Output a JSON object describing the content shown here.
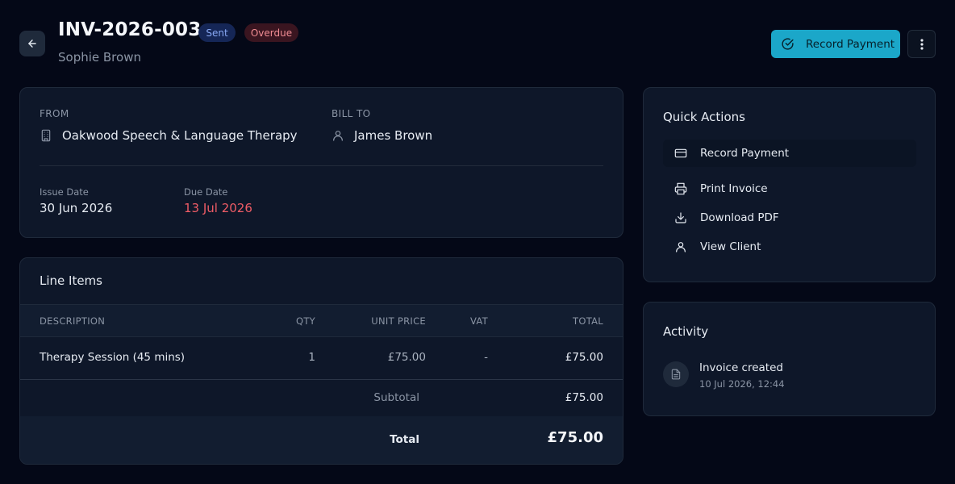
{
  "header": {
    "invoice_number": "INV-2026-003",
    "client_name": "Sophie Brown",
    "badges": {
      "sent": "Sent",
      "overdue": "Overdue"
    },
    "record_payment_label": "Record Payment"
  },
  "details": {
    "from_label": "FROM",
    "from_name": "Oakwood Speech & Language Therapy",
    "bill_to_label": "BILL TO",
    "bill_to_name": "James Brown",
    "issue_date_label": "Issue Date",
    "issue_date": "30 Jun 2026",
    "due_date_label": "Due Date",
    "due_date": "13 Jul 2026"
  },
  "line_items": {
    "title": "Line Items",
    "columns": {
      "description": "DESCRIPTION",
      "qty": "QTY",
      "unit_price": "UNIT PRICE",
      "vat": "VAT",
      "total": "TOTAL"
    },
    "rows": [
      {
        "description": "Therapy Session (45 mins)",
        "qty": "1",
        "unit_price": "£75.00",
        "vat": "-",
        "total": "£75.00"
      }
    ],
    "subtotal_label": "Subtotal",
    "subtotal": "£75.00",
    "total_label": "Total",
    "total": "£75.00"
  },
  "quick_actions": {
    "title": "Quick Actions",
    "items": [
      {
        "label": "Record Payment",
        "icon": "credit-card-icon"
      },
      {
        "label": "Print Invoice",
        "icon": "printer-icon"
      },
      {
        "label": "Download PDF",
        "icon": "download-icon"
      },
      {
        "label": "View Client",
        "icon": "user-icon"
      }
    ]
  },
  "activity": {
    "title": "Activity",
    "items": [
      {
        "title": "Invoice created",
        "time": "10 Jul 2026, 12:44",
        "icon": "document-icon"
      }
    ]
  },
  "colors": {
    "background": "#040817",
    "card": "#0e1729",
    "accent": "#1ba7c9",
    "overdue": "#ef5c66",
    "sent_badge": "#88a8f4"
  }
}
